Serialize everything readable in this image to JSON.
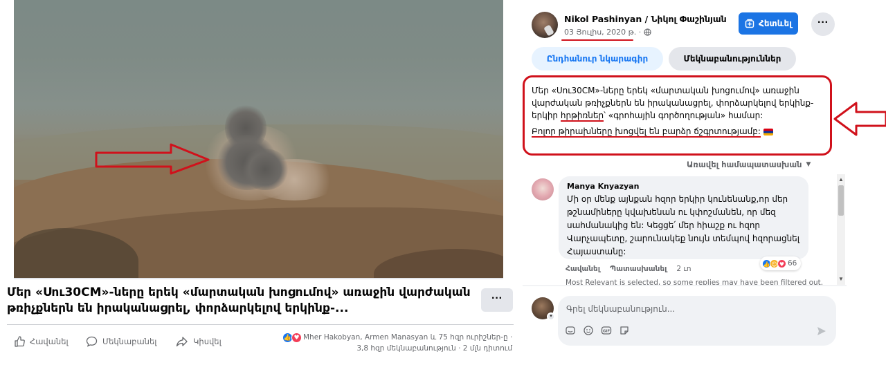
{
  "video": {
    "title": "Մեր «Սու30CM»-ները երեկ «մարտական խոցումով» առաջին վարժական թռիչքներն են իրականացրել, փորձարկելով երկինք-..."
  },
  "actions": {
    "like": "Հավանել",
    "comment": "Մեկնաբանել",
    "share": "Կիսվել"
  },
  "reactions_summary": {
    "names": "Mher Hakobyan, Armen Manasyan և 75 հզր ուրիշներ-ը ·",
    "stats": "3,8 հզր մեկնաբանություն · 2 մլն դիտում"
  },
  "post": {
    "author": "Nikol Pashinyan / Նիկոլ Փաշինյան",
    "date": "03 Յուլիս, 2020 թ. ·",
    "privacy_icon": "globe-icon",
    "follow_label": "Հետևել",
    "tab_overview": "Ընդհանուր նկարագիր",
    "tab_comments": "Մեկնաբանություններ",
    "body_line1_a": "Մեր «Սու30CM»-ները երեկ «մարտական խոցումով» առաջին վարժական թռիչքներն են իրականացրել, փորձարկելով երկինք-երկիր ",
    "body_line1_b": "հրթիռներ",
    "body_line1_c": "՝ «գրոհային գործողության» համար:",
    "body_line2": "Բոլոր թիրախները խոցվել են բարձր ճշգրտությամբ:"
  },
  "sort_label": "Առավել համապատասխան",
  "comment": {
    "author": "Manya Knyazyan",
    "text": "Մի օր մենք այնքան հզոր երկիր կունենանք,որ մեր թշնամիները կվախենան ու կփոշմանեն, որ մեզ սահմանակից են: Կեցցե՛ մեր հիաշք ու հզոր Վարչապետը, շարունակեք նույն տեմպով հզորացնել Հայաստանը:",
    "reaction_count": "66",
    "like": "Հավանել",
    "reply": "Պատասխանել",
    "age": "2 ւո",
    "filter_note": "Most Relevant is selected, so some replies may have been filtered out."
  },
  "composer": {
    "placeholder": "Գրել մեկնաբանություն..."
  },
  "colors": {
    "accent": "#1b74e4",
    "annotation_red": "#d0111b"
  }
}
